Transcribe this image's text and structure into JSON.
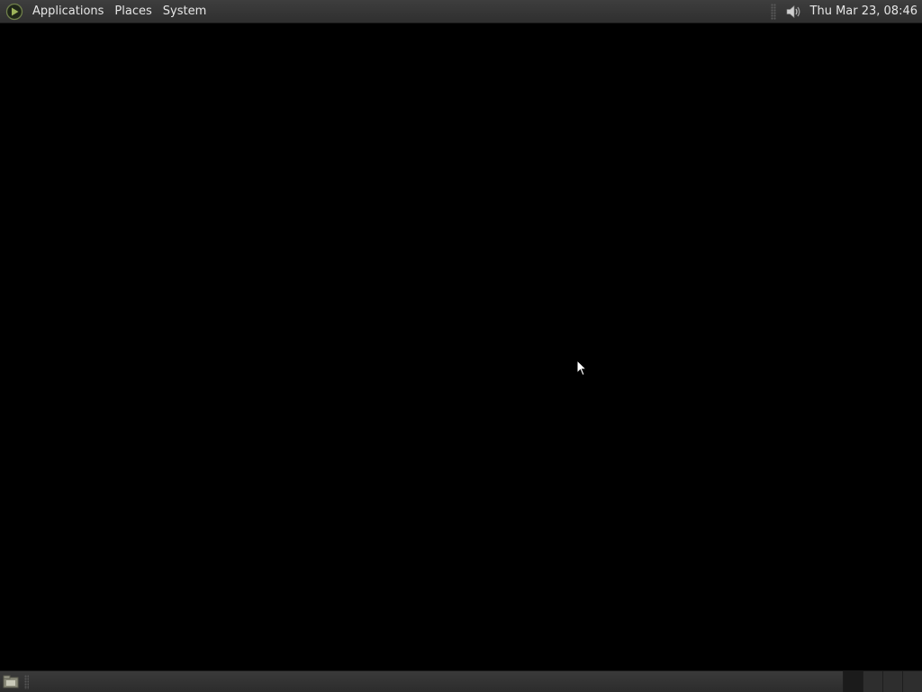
{
  "top_panel": {
    "logo_icon": "distro-logo-icon",
    "menus": {
      "applications": "Applications",
      "places": "Places",
      "system": "System"
    },
    "tray": {
      "volume_icon": "speaker-icon",
      "clock": "Thu Mar 23, 08:46"
    }
  },
  "bottom_panel": {
    "show_desktop_icon": "show-desktop-icon",
    "workspaces": [
      {
        "active": true
      },
      {
        "active": false
      },
      {
        "active": false
      },
      {
        "active": false
      }
    ]
  },
  "colors": {
    "desktop_background": "#000000",
    "panel_background": "#363636",
    "panel_text": "#e6e6e6",
    "logo_accent": "#8fa64a"
  }
}
